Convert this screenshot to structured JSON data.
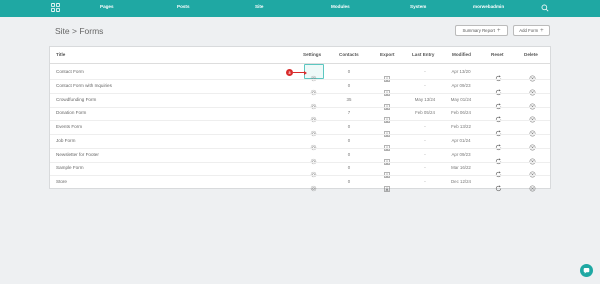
{
  "nav": {
    "items": [
      "Pages",
      "Posts",
      "Site",
      "Modules",
      "System",
      "morwebadmin"
    ]
  },
  "page": {
    "title": "Site > Forms"
  },
  "buttons": {
    "summary_report": "Summary Report",
    "add_form": "Add Form"
  },
  "table": {
    "headers": [
      "Title",
      "Settings",
      "Contacts",
      "Export",
      "Last Entry",
      "Modified",
      "Reset",
      "Delete"
    ],
    "rows": [
      {
        "title": "Contact Form",
        "contacts": "0",
        "last_entry": "-",
        "modified": "Apr 13/20"
      },
      {
        "title": "Contact Form with Inquiries",
        "contacts": "0",
        "last_entry": "-",
        "modified": "Apr 09/23"
      },
      {
        "title": "Crowdfunding Form",
        "contacts": "35",
        "last_entry": "May 13/24",
        "modified": "May 01/24"
      },
      {
        "title": "Donation Form",
        "contacts": "7",
        "last_entry": "Feb 05/24",
        "modified": "Feb 06/24"
      },
      {
        "title": "Events Form",
        "contacts": "0",
        "last_entry": "-",
        "modified": "Feb 13/22"
      },
      {
        "title": "Job Form",
        "contacts": "0",
        "last_entry": "-",
        "modified": "Apr 01/24"
      },
      {
        "title": "Newsletter for Footer",
        "contacts": "0",
        "last_entry": "-",
        "modified": "Apr 09/23"
      },
      {
        "title": "Sample Form",
        "contacts": "0",
        "last_entry": "-",
        "modified": "Mar 16/22"
      },
      {
        "title": "Store",
        "contacts": "0",
        "last_entry": "-",
        "modified": "Dec 12/24"
      }
    ]
  },
  "annotation": {
    "step": "3"
  },
  "colors": {
    "accent": "#1fa8a3",
    "marker": "#d92b2b"
  }
}
